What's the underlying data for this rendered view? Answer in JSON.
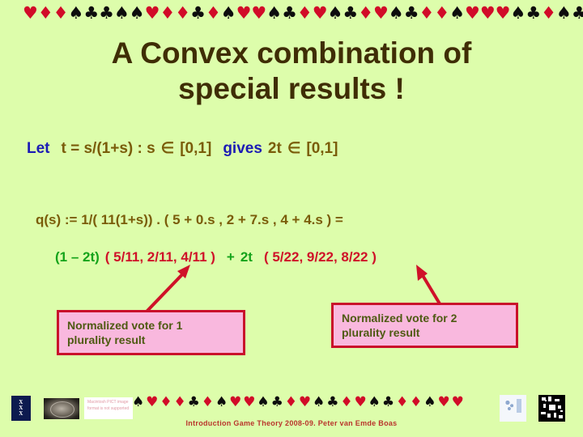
{
  "slide": {
    "background_color": "#ddfdab",
    "title": "A Convex combination of\nspecial results !",
    "title_color": "#3f2d05"
  },
  "decor": {
    "top_suits": [
      "heart",
      "diamond",
      "diamond",
      "spade",
      "club",
      "club",
      "spade",
      "spade",
      "heart",
      "diamond",
      "diamond",
      "club",
      "diamond",
      "spade",
      "heart",
      "heart",
      "spade",
      "club",
      "diamond",
      "heart",
      "spade",
      "club",
      "diamond",
      "heart",
      "spade",
      "club",
      "diamond",
      "diamond",
      "spade",
      "heart",
      "heart",
      "heart",
      "spade",
      "club",
      "diamond",
      "spade",
      "club",
      "club"
    ],
    "bottom_suits": [
      "spade",
      "heart",
      "diamond",
      "diamond",
      "club",
      "diamond",
      "spade",
      "heart",
      "heart",
      "spade",
      "club",
      "diamond",
      "heart",
      "spade",
      "club",
      "diamond",
      "heart",
      "spade",
      "club",
      "diamond",
      "diamond",
      "spade",
      "heart",
      "heart"
    ],
    "red_color": "#d10b28",
    "black_color": "#0d0d0d"
  },
  "body": {
    "let_line": {
      "keyword_let": "Let",
      "expr_1": "t =  s/(1+s) :  s",
      "member_symbol": "∈",
      "interval_1": "[0,1]",
      "keyword_gives": "gives",
      "expr_2": "2t",
      "interval_2": "[0,1]"
    },
    "q_line": "q(s) :=  1/( 11(1+s)) . ( 5 + 0.s  ,  2 + 7.s  ,  4 + 4.s )  =",
    "convex_line": {
      "coefficient_1": "(1 – 2t)",
      "vector_1": "( 5/11, 2/11, 4/11 )",
      "plus": "+",
      "coefficient_2": "2t",
      "vector_2": "( 5/22, 9/22, 8/22 )",
      "green_color": "#14a31a",
      "red_color": "#cf1128"
    }
  },
  "callouts": [
    {
      "line1": "Normalized  vote for  1",
      "line2": "plurality result",
      "fill_color": "#f9b8de",
      "border_color": "#c9102b",
      "text_color": "#4e5a12"
    },
    {
      "line1": "Normalized  vote for  2",
      "line2": "plurality result",
      "fill_color": "#f9b8de",
      "border_color": "#c9102b",
      "text_color": "#4e5a12"
    }
  ],
  "footer": {
    "caption": "Introduction Game Theory 2008-09.   Peter van Emde Boas",
    "caption_color": "#b9342c",
    "uva_logo": {
      "line1": "X",
      "line2": "X",
      "line3": "X"
    },
    "pict_placeholder": "Macintosh PICT image format is not supported"
  }
}
